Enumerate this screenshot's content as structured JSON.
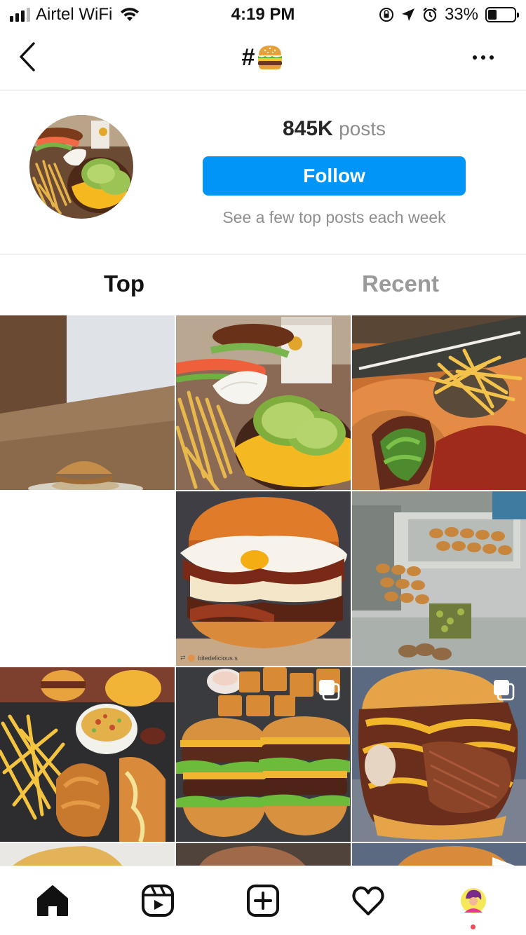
{
  "status_bar": {
    "carrier": "Airtel WiFi",
    "time": "4:19 PM",
    "battery_percent": "33%",
    "battery_level": 0.33,
    "icons": [
      "signal-bars-icon",
      "wifi-icon",
      "orientation-lock-icon",
      "location-arrow-icon",
      "alarm-icon",
      "battery-icon"
    ]
  },
  "nav": {
    "title_hash": "#",
    "title_emoji_name": "hamburger-emoji",
    "back_icon": "chevron-left-icon",
    "more_icon": "more-horizontal-icon"
  },
  "header": {
    "post_count": "845K",
    "post_label": "posts",
    "follow_label": "Follow",
    "subtext": "See a few top posts each week"
  },
  "tabs": {
    "top_label": "Top",
    "recent_label": "Recent",
    "active": "Top"
  },
  "grid": {
    "posts": [
      {
        "name": "post-burger-buns",
        "badge": "reels-icon"
      },
      {
        "name": "post-avocado-burger",
        "badge": ""
      },
      {
        "name": "post-burger-fries-box",
        "badge": ""
      },
      {
        "name": "post-egg-bacon-burger",
        "badge": "",
        "credit": "bitedelicious.s"
      },
      {
        "name": "post-kitchen-sliders",
        "badge": ""
      },
      {
        "name": "post-platter-fries-chicken",
        "badge": ""
      },
      {
        "name": "post-double-burgers-waffle-fries",
        "badge": "carousel-icon"
      },
      {
        "name": "post-brisket-burger",
        "badge": "carousel-icon"
      }
    ]
  },
  "tab_bar": {
    "items": [
      "home-icon",
      "reels-icon",
      "new-post-icon",
      "activity-heart-icon",
      "profile-avatar"
    ]
  },
  "colors": {
    "accent": "#0095f6",
    "text_primary": "#262626",
    "text_secondary": "#8e8e8e",
    "divider": "#dbdbdb",
    "notification_dot": "#ed4956"
  }
}
